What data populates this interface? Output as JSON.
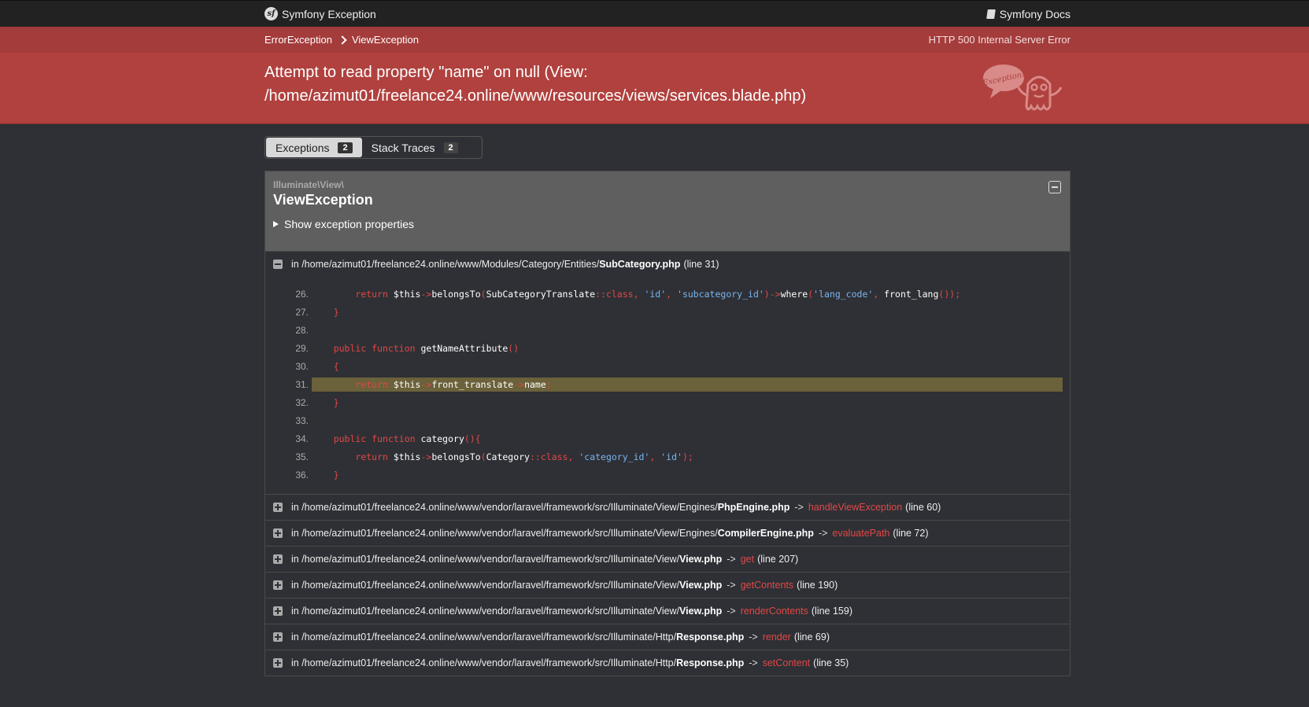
{
  "topbar": {
    "brand_label": "Symfony Exception",
    "docs_label": "Symfony Docs"
  },
  "breadcrumb": {
    "items": [
      "ErrorException",
      "ViewException"
    ],
    "status": "HTTP 500 Internal Server Error"
  },
  "header": {
    "title_line1": "Attempt to read property \"name\" on null (View:",
    "title_line2": "/home/azimut01/freelance24.online/www/resources/views/services.blade.php)",
    "ghost_bubble_text": "Exception!"
  },
  "tabs": [
    {
      "label": "Exceptions",
      "count": "2"
    },
    {
      "label": "Stack Traces",
      "count": "2"
    }
  ],
  "exception": {
    "namespace": "Illuminate\\View\\",
    "class": "ViewException",
    "show_props_label": "Show exception properties"
  },
  "first_trace": {
    "prefix": "in /home/azimut01/freelance24.online/www/Modules/Category/Entities/",
    "file": "SubCategory.php",
    "line": "(line 31)"
  },
  "code": {
    "line_numbers": [
      "26.",
      "27.",
      "28.",
      "29.",
      "30.",
      "31.",
      "32.",
      "33.",
      "34.",
      "35.",
      "36."
    ]
  },
  "traces": [
    {
      "prefix": "in /home/azimut01/freelance24.online/www/vendor/laravel/framework/src/Illuminate/View/Engines/",
      "file": "PhpEngine.php",
      "arrow": "->",
      "fn": "handleViewException",
      "line": "(line 60)"
    },
    {
      "prefix": "in /home/azimut01/freelance24.online/www/vendor/laravel/framework/src/Illuminate/View/Engines/",
      "file": "CompilerEngine.php",
      "arrow": "->",
      "fn": "evaluatePath",
      "line": "(line 72)"
    },
    {
      "prefix": "in /home/azimut01/freelance24.online/www/vendor/laravel/framework/src/Illuminate/View/",
      "file": "View.php",
      "arrow": "->",
      "fn": "get",
      "line": "(line 207)"
    },
    {
      "prefix": "in /home/azimut01/freelance24.online/www/vendor/laravel/framework/src/Illuminate/View/",
      "file": "View.php",
      "arrow": "->",
      "fn": "getContents",
      "line": "(line 190)"
    },
    {
      "prefix": "in /home/azimut01/freelance24.online/www/vendor/laravel/framework/src/Illuminate/View/",
      "file": "View.php",
      "arrow": "->",
      "fn": "renderContents",
      "line": "(line 159)"
    },
    {
      "prefix": "in /home/azimut01/freelance24.online/www/vendor/laravel/framework/src/Illuminate/Http/",
      "file": "Response.php",
      "arrow": "->",
      "fn": "render",
      "line": "(line 69)"
    },
    {
      "prefix": "in /home/azimut01/freelance24.online/www/vendor/laravel/framework/src/Illuminate/Http/",
      "file": "Response.php",
      "arrow": "->",
      "fn": "setContent",
      "line": "(line 35)"
    }
  ],
  "colors": {
    "header_red": "#b0413e",
    "breadcrumb_red": "#a43c3b",
    "background": "#2e3035",
    "function_red": "#e04848",
    "string_blue": "#7cb4f0",
    "highlight": "#6b613a"
  }
}
